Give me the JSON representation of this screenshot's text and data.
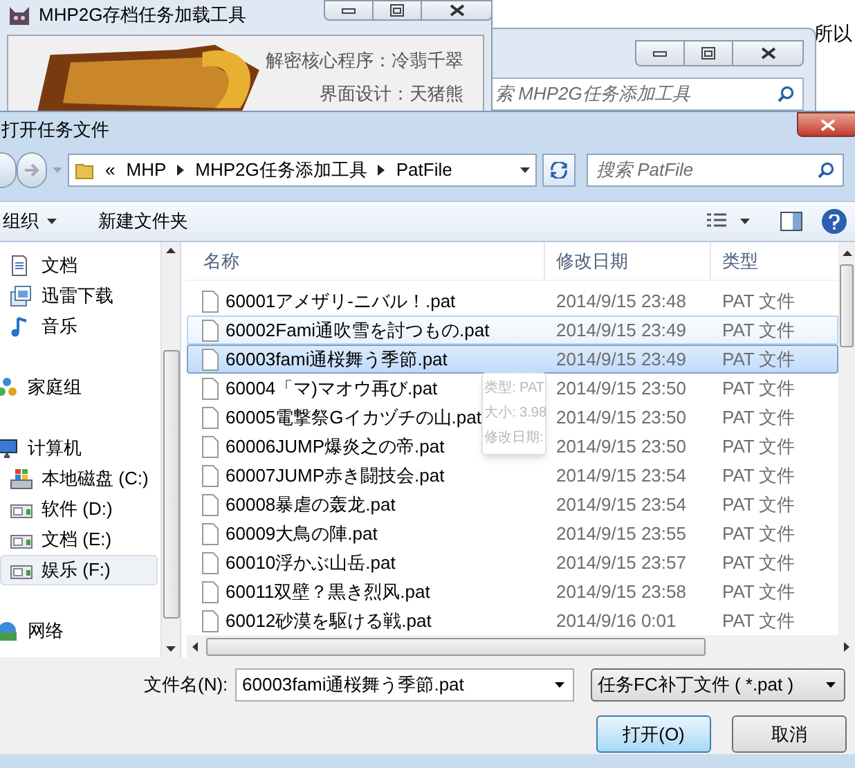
{
  "background_page": {
    "text": "所以"
  },
  "loader_window": {
    "title": "MHP2G存档任务加载工具",
    "credits": [
      "解密核心程序：冷翡千翠",
      "界面设计：天猪熊"
    ]
  },
  "explorer_window": {
    "search": {
      "placeholder": "索 MHP2G任务添加工具"
    }
  },
  "dialog": {
    "title": "打开任务文件",
    "breadcrumb": {
      "overflow": "«",
      "parts": [
        "MHP",
        "MHP2G任务添加工具",
        "PatFile"
      ]
    },
    "search": {
      "placeholder": "搜索 PatFile"
    },
    "toolbar": {
      "organize": "组织",
      "new_folder": "新建文件夹"
    },
    "sidebar": {
      "sections": [
        {
          "items": [
            {
              "label": "文档",
              "kind": "document",
              "selected": false
            },
            {
              "label": "迅雷下载",
              "kind": "download",
              "selected": false
            },
            {
              "label": "音乐",
              "kind": "music",
              "selected": false
            }
          ]
        },
        {
          "items": [
            {
              "label": "家庭组",
              "kind": "homegroup",
              "selected": false
            }
          ]
        },
        {
          "items": [
            {
              "label": "计算机",
              "kind": "computer",
              "selected": false,
              "children": [
                {
                  "label": "本地磁盘 (C:)",
                  "kind": "system-drive",
                  "selected": false
                },
                {
                  "label": "软件 (D:)",
                  "kind": "drive",
                  "selected": false
                },
                {
                  "label": "文档 (E:)",
                  "kind": "drive",
                  "selected": false
                },
                {
                  "label": "娱乐 (F:)",
                  "kind": "drive",
                  "selected": true
                }
              ]
            }
          ]
        },
        {
          "items": [
            {
              "label": "网络",
              "kind": "network",
              "selected": false
            }
          ]
        }
      ]
    },
    "table": {
      "columns": [
        "名称",
        "修改日期",
        "类型"
      ],
      "rows": [
        {
          "name": "60001アメザリ-ニバル！.pat",
          "date": "2014/9/15 23:48",
          "type": "PAT 文件",
          "selected": false,
          "hovered": false
        },
        {
          "name": "60002Fami通吹雪を討つもの.pat",
          "date": "2014/9/15 23:49",
          "type": "PAT 文件",
          "selected": false,
          "hovered": true
        },
        {
          "name": "60003fami通桜舞う季節.pat",
          "date": "2014/9/15 23:49",
          "type": "PAT 文件",
          "selected": true,
          "hovered": false
        },
        {
          "name": "60004「マ)マオウ再び.pat",
          "date": "2014/9/15 23:50",
          "type": "PAT 文件",
          "selected": false,
          "hovered": false
        },
        {
          "name": "60005電撃祭Gイカヅチの山.pat",
          "date": "2014/9/15 23:50",
          "type": "PAT 文件",
          "selected": false,
          "hovered": false
        },
        {
          "name": "60006JUMP爆炎之の帝.pat",
          "date": "2014/9/15 23:50",
          "type": "PAT 文件",
          "selected": false,
          "hovered": false
        },
        {
          "name": "60007JUMP赤き闘技会.pat",
          "date": "2014/9/15 23:54",
          "type": "PAT 文件",
          "selected": false,
          "hovered": false
        },
        {
          "name": "60008暴虐の轰龙.pat",
          "date": "2014/9/15 23:54",
          "type": "PAT 文件",
          "selected": false,
          "hovered": false
        },
        {
          "name": "60009大鳥の陣.pat",
          "date": "2014/9/15 23:55",
          "type": "PAT 文件",
          "selected": false,
          "hovered": false
        },
        {
          "name": "60010浮かぶ山岳.pat",
          "date": "2014/9/15 23:57",
          "type": "PAT 文件",
          "selected": false,
          "hovered": false
        },
        {
          "name": "60011双壁？黒き烈风.pat",
          "date": "2014/9/15 23:58",
          "type": "PAT 文件",
          "selected": false,
          "hovered": false
        },
        {
          "name": "60012砂漠を駆ける戦.pat",
          "date": "2014/9/16 0:01",
          "type": "PAT 文件",
          "selected": false,
          "hovered": false
        }
      ]
    },
    "tooltip": {
      "lines": [
        "类型: PAT",
        "大小: 3.98",
        "修改日期:"
      ]
    },
    "filename": {
      "label": "文件名(N):",
      "value": "60003fami通桜舞う季節.pat"
    },
    "filetype": {
      "value": "任务FC补丁文件 ( *.pat )"
    },
    "buttons": [
      {
        "label": "打开(O)",
        "default": true
      },
      {
        "label": "取消",
        "default": false
      }
    ]
  }
}
